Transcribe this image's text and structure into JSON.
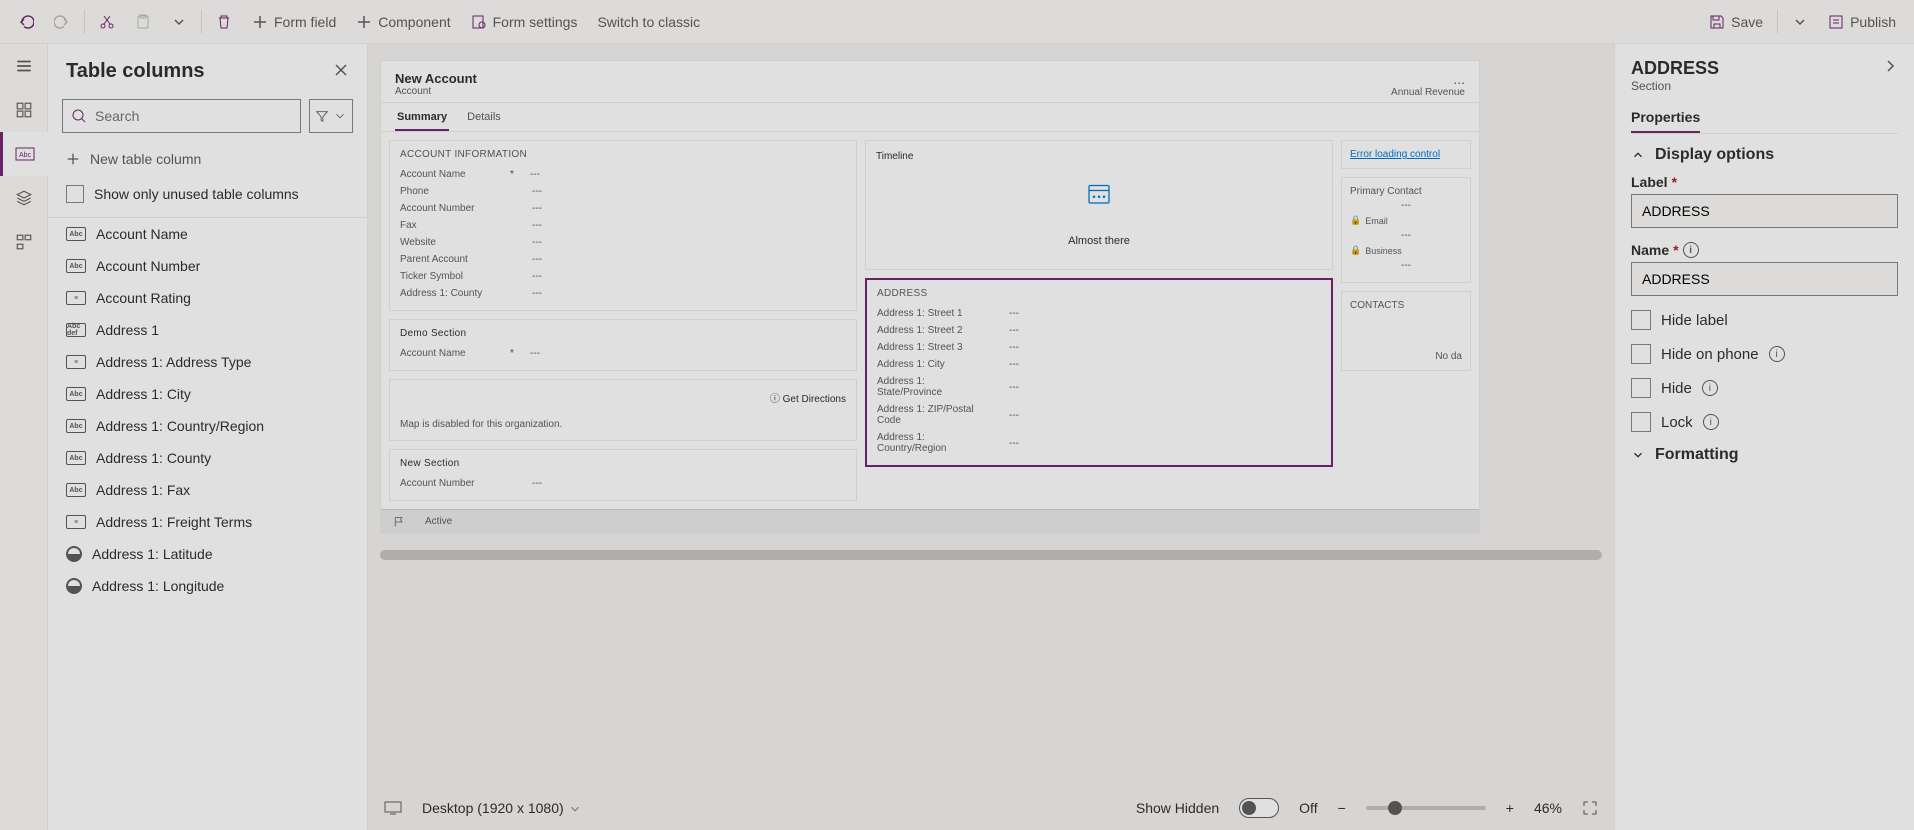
{
  "toolbar": {
    "form_field": "Form field",
    "component": "Component",
    "form_settings": "Form settings",
    "switch_classic": "Switch to classic",
    "save": "Save",
    "publish": "Publish"
  },
  "columns_panel": {
    "title": "Table columns",
    "search_placeholder": "Search",
    "new_column": "New table column",
    "unused_only": "Show only unused table columns",
    "items": [
      {
        "label": "Account Name",
        "icon": "Abc"
      },
      {
        "label": "Account Number",
        "icon": "Abc"
      },
      {
        "label": "Account Rating",
        "icon": "opt"
      },
      {
        "label": "Address 1",
        "icon": "Abc\ndef"
      },
      {
        "label": "Address 1: Address Type",
        "icon": "opt"
      },
      {
        "label": "Address 1: City",
        "icon": "Abc"
      },
      {
        "label": "Address 1: Country/Region",
        "icon": "Abc"
      },
      {
        "label": "Address 1: County",
        "icon": "Abc"
      },
      {
        "label": "Address 1: Fax",
        "icon": "Abc"
      },
      {
        "label": "Address 1: Freight Terms",
        "icon": "opt"
      },
      {
        "label": "Address 1: Latitude",
        "icon": "half"
      },
      {
        "label": "Address 1: Longitude",
        "icon": "half"
      }
    ]
  },
  "form": {
    "title": "New Account",
    "entity": "Account",
    "header_field": "Annual Revenue",
    "tabs": [
      "Summary",
      "Details"
    ],
    "active_tab": 0,
    "sections": {
      "account_info": {
        "title": "ACCOUNT INFORMATION",
        "fields": [
          {
            "label": "Account Name",
            "required": true,
            "value": "---"
          },
          {
            "label": "Phone",
            "value": "---"
          },
          {
            "label": "Account Number",
            "value": "---"
          },
          {
            "label": "Fax",
            "value": "---"
          },
          {
            "label": "Website",
            "value": "---"
          },
          {
            "label": "Parent Account",
            "value": "---"
          },
          {
            "label": "Ticker Symbol",
            "value": "---"
          },
          {
            "label": "Address 1: County",
            "value": "---"
          }
        ]
      },
      "demo": {
        "title": "Demo Section",
        "fields": [
          {
            "label": "Account Name",
            "required": true,
            "value": "---"
          }
        ]
      },
      "map": {
        "directions": "Get Directions",
        "disabled": "Map is disabled for this organization."
      },
      "new_section": {
        "title": "New Section",
        "fields": [
          {
            "label": "Account Number",
            "value": "---"
          }
        ]
      },
      "timeline": {
        "title": "Timeline",
        "status": "Almost there"
      },
      "address": {
        "title": "ADDRESS",
        "fields": [
          {
            "label": "Address 1: Street 1",
            "value": "---"
          },
          {
            "label": "Address 1: Street 2",
            "value": "---"
          },
          {
            "label": "Address 1: Street 3",
            "value": "---"
          },
          {
            "label": "Address 1: City",
            "value": "---"
          },
          {
            "label": "Address 1: State/Province",
            "value": "---"
          },
          {
            "label": "Address 1: ZIP/Postal Code",
            "value": "---"
          },
          {
            "label": "Address 1: Country/Region",
            "value": "---"
          }
        ]
      },
      "sidecol": {
        "error": "Error loading control",
        "primary_contact": "Primary Contact",
        "email": "Email",
        "business": "Business",
        "contacts": "CONTACTS",
        "nodata": "No da"
      }
    },
    "status_bar": "Active"
  },
  "view_controls": {
    "viewport": "Desktop (1920 x 1080)",
    "show_hidden": "Show Hidden",
    "toggle_state": "Off",
    "zoom": "46%"
  },
  "properties": {
    "title": "ADDRESS",
    "type": "Section",
    "tab": "Properties",
    "group_display": "Display options",
    "label_label": "Label",
    "label_value": "ADDRESS",
    "name_label": "Name",
    "name_value": "ADDRESS",
    "hide_label": "Hide label",
    "hide_phone": "Hide on phone",
    "hide": "Hide",
    "lock": "Lock",
    "group_formatting": "Formatting"
  }
}
